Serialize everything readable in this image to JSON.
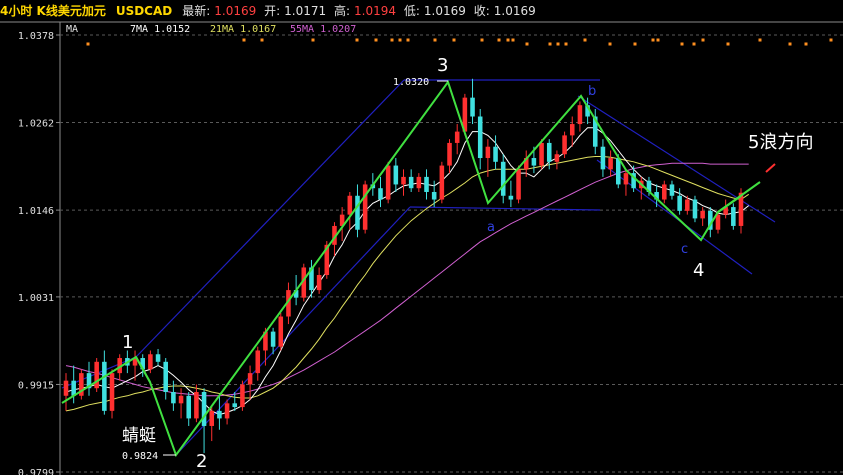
{
  "header": {
    "title": "4小时 K线美元加元",
    "symbol": "USDCAD",
    "latest_label": "最新:",
    "latest": "1.0169",
    "open_label": "开:",
    "open": "1.0171",
    "high_label": "高:",
    "high": "1.0194",
    "low_label": "低:",
    "low": "1.0169",
    "close_label": "收:",
    "close": "1.0169"
  },
  "ma_legend": {
    "label": "MA",
    "ma7": "7MA 1.0152",
    "ma21": "21MA 1.0167",
    "ma55": "55MA 1.0207"
  },
  "colors": {
    "up": "#ff3030",
    "down": "#40e0e0",
    "ma7": "#ffffff",
    "ma21": "#e0e060",
    "ma55": "#d060d0",
    "wave": "#40e040",
    "channel": "#2020c0",
    "grid": "#5a5a5a"
  },
  "annotations": {
    "w1": "1",
    "w2": "2",
    "w3": "3",
    "w4": "4",
    "w5": "5浪方向",
    "a": "a",
    "b": "b",
    "c": "c",
    "dragonfly": "蜻蜓",
    "high_price": "1.0320",
    "low_price": "0.9824"
  },
  "chart_data": {
    "type": "candlestick",
    "y_ticks": [
      "1.0378",
      "1.0262",
      "1.0146",
      "1.0031",
      "0.9915",
      "0.9799"
    ],
    "ylim": [
      0.9799,
      1.0378
    ],
    "candles": [
      [
        0.99,
        0.993,
        0.988,
        0.992
      ],
      [
        0.992,
        0.994,
        0.989,
        0.99
      ],
      [
        0.99,
        0.9935,
        0.9895,
        0.993
      ],
      [
        0.993,
        0.9945,
        0.99,
        0.991
      ],
      [
        0.991,
        0.995,
        0.9905,
        0.9945
      ],
      [
        0.9945,
        0.996,
        0.9875,
        0.988
      ],
      [
        0.988,
        0.9935,
        0.987,
        0.993
      ],
      [
        0.993,
        0.9955,
        0.992,
        0.995
      ],
      [
        0.995,
        0.996,
        0.993,
        0.994
      ],
      [
        0.994,
        0.996,
        0.992,
        0.995
      ],
      [
        0.995,
        0.9955,
        0.9925,
        0.9935
      ],
      [
        0.9935,
        0.996,
        0.993,
        0.9955
      ],
      [
        0.9955,
        0.9962,
        0.994,
        0.9945
      ],
      [
        0.9945,
        0.995,
        0.9895,
        0.9905
      ],
      [
        0.9905,
        0.992,
        0.988,
        0.989
      ],
      [
        0.989,
        0.991,
        0.987,
        0.99
      ],
      [
        0.99,
        0.9905,
        0.986,
        0.987
      ],
      [
        0.987,
        0.9915,
        0.9865,
        0.9905
      ],
      [
        0.9905,
        0.991,
        0.9824,
        0.986
      ],
      [
        0.986,
        0.9885,
        0.984,
        0.988
      ],
      [
        0.988,
        0.99,
        0.9855,
        0.987
      ],
      [
        0.987,
        0.9895,
        0.9862,
        0.989
      ],
      [
        0.989,
        0.9905,
        0.988,
        0.9885
      ],
      [
        0.9885,
        0.992,
        0.988,
        0.9915
      ],
      [
        0.9915,
        0.994,
        0.9895,
        0.993
      ],
      [
        0.993,
        0.9965,
        0.992,
        0.996
      ],
      [
        0.996,
        0.999,
        0.994,
        0.9985
      ],
      [
        0.9985,
        0.999,
        0.9955,
        0.9965
      ],
      [
        0.9965,
        1.001,
        0.996,
        1.0005
      ],
      [
        1.0005,
        1.005,
        0.9995,
        1.004
      ],
      [
        1.004,
        1.006,
        1.002,
        1.003
      ],
      [
        1.003,
        1.0075,
        1.0025,
        1.007
      ],
      [
        1.007,
        1.008,
        1.003,
        1.004
      ],
      [
        1.004,
        1.007,
        1.0035,
        1.006
      ],
      [
        1.006,
        1.0105,
        1.0055,
        1.01
      ],
      [
        1.01,
        1.013,
        1.0085,
        1.0125
      ],
      [
        1.0125,
        1.015,
        1.0105,
        1.014
      ],
      [
        1.014,
        1.017,
        1.012,
        1.0165
      ],
      [
        1.0165,
        1.018,
        1.011,
        1.012
      ],
      [
        1.012,
        1.0185,
        1.0115,
        1.018
      ],
      [
        1.018,
        1.0195,
        1.0165,
        1.0175
      ],
      [
        1.0175,
        1.019,
        1.015,
        1.016
      ],
      [
        1.016,
        1.021,
        1.0155,
        1.0205
      ],
      [
        1.0205,
        1.0215,
        1.017,
        1.018
      ],
      [
        1.018,
        1.02,
        1.0165,
        1.019
      ],
      [
        1.019,
        1.02,
        1.017,
        1.0175
      ],
      [
        1.0175,
        1.0195,
        1.017,
        1.019
      ],
      [
        1.019,
        1.02,
        1.016,
        1.017
      ],
      [
        1.017,
        1.0185,
        1.015,
        1.016
      ],
      [
        1.016,
        1.021,
        1.0155,
        1.0205
      ],
      [
        1.0205,
        1.024,
        1.0195,
        1.0235
      ],
      [
        1.0235,
        1.026,
        1.022,
        1.025
      ],
      [
        1.025,
        1.03,
        1.0245,
        1.0295
      ],
      [
        1.0295,
        1.032,
        1.026,
        1.027
      ],
      [
        1.027,
        1.028,
        1.02,
        1.0215
      ],
      [
        1.0215,
        1.024,
        1.019,
        1.023
      ],
      [
        1.023,
        1.0245,
        1.02,
        1.021
      ],
      [
        1.021,
        1.022,
        1.0155,
        1.0165
      ],
      [
        1.0165,
        1.0185,
        1.015,
        1.016
      ],
      [
        1.016,
        1.0205,
        1.0155,
        1.02
      ],
      [
        1.02,
        1.0225,
        1.019,
        1.0215
      ],
      [
        1.0215,
        1.023,
        1.0195,
        1.0205
      ],
      [
        1.0205,
        1.024,
        1.02,
        1.0235
      ],
      [
        1.0235,
        1.024,
        1.02,
        1.021
      ],
      [
        1.021,
        1.0225,
        1.02,
        1.022
      ],
      [
        1.022,
        1.025,
        1.0215,
        1.0245
      ],
      [
        1.0245,
        1.027,
        1.023,
        1.026
      ],
      [
        1.026,
        1.029,
        1.025,
        1.0285
      ],
      [
        1.0285,
        1.0295,
        1.026,
        1.027
      ],
      [
        1.027,
        1.028,
        1.022,
        1.023
      ],
      [
        1.023,
        1.024,
        1.019,
        1.02
      ],
      [
        1.02,
        1.0225,
        1.019,
        1.0215
      ],
      [
        1.0215,
        1.022,
        1.0175,
        1.018
      ],
      [
        1.018,
        1.02,
        1.0165,
        1.0195
      ],
      [
        1.0195,
        1.0205,
        1.017,
        1.0175
      ],
      [
        1.0175,
        1.019,
        1.016,
        1.0185
      ],
      [
        1.0185,
        1.019,
        1.0165,
        1.017
      ],
      [
        1.017,
        1.018,
        1.015,
        1.016
      ],
      [
        1.016,
        1.0185,
        1.0155,
        1.018
      ],
      [
        1.018,
        1.0185,
        1.016,
        1.0165
      ],
      [
        1.0165,
        1.0175,
        1.014,
        1.0145
      ],
      [
        1.0145,
        1.0165,
        1.014,
        1.016
      ],
      [
        1.016,
        1.0165,
        1.013,
        1.0135
      ],
      [
        1.0135,
        1.015,
        1.0125,
        1.0145
      ],
      [
        1.0145,
        1.015,
        1.011,
        1.012
      ],
      [
        1.012,
        1.0145,
        1.0115,
        1.014
      ],
      [
        1.014,
        1.016,
        1.0135,
        1.015
      ],
      [
        1.015,
        1.0155,
        1.012,
        1.0125
      ],
      [
        1.0125,
        1.0175,
        1.0115,
        1.0169
      ]
    ],
    "ma7": [
      0.9905,
      0.9908,
      0.991,
      0.9912,
      0.9915,
      0.9912,
      0.991,
      0.9915,
      0.992,
      0.9925,
      0.9932,
      0.9935,
      0.994,
      0.9935,
      0.9927,
      0.9918,
      0.9908,
      0.99,
      0.989,
      0.988,
      0.9875,
      0.9878,
      0.9882,
      0.9887,
      0.9895,
      0.9908,
      0.9925,
      0.994,
      0.996,
      0.9982,
      1.0,
      1.002,
      1.0035,
      1.005,
      1.0065,
      1.0085,
      1.01,
      1.012,
      1.013,
      1.0145,
      1.0155,
      1.016,
      1.0165,
      1.0172,
      1.0178,
      1.018,
      1.0182,
      1.018,
      1.0178,
      1.0185,
      1.0195,
      1.021,
      1.0235,
      1.025,
      1.025,
      1.0245,
      1.0235,
      1.022,
      1.0205,
      1.0195,
      1.0195,
      1.019,
      1.02,
      1.021,
      1.0215,
      1.0222,
      1.0232,
      1.0245,
      1.0255,
      1.0255,
      1.0248,
      1.0238,
      1.0225,
      1.0212,
      1.02,
      1.019,
      1.0182,
      1.0178,
      1.0175,
      1.0172,
      1.0168,
      1.0162,
      1.0158,
      1.0152,
      1.0148,
      1.0142,
      1.014,
      1.0142,
      1.0144,
      1.0152
    ],
    "ma21": [
      0.988,
      0.9882,
      0.9885,
      0.9888,
      0.989,
      0.9892,
      0.9895,
      0.9898,
      0.99,
      0.9903,
      0.9905,
      0.9908,
      0.991,
      0.9912,
      0.9913,
      0.9913,
      0.9912,
      0.991,
      0.9908,
      0.9905,
      0.9903,
      0.99,
      0.9898,
      0.9897,
      0.9897,
      0.99,
      0.9905,
      0.991,
      0.9918,
      0.9928,
      0.9938,
      0.995,
      0.9962,
      0.9975,
      0.999,
      1.0003,
      1.0018,
      1.0032,
      1.0047,
      1.006,
      1.0075,
      1.0088,
      1.01,
      1.0112,
      1.0122,
      1.0132,
      1.014,
      1.0148,
      1.0155,
      1.0162,
      1.0168,
      1.0175,
      1.0182,
      1.019,
      1.0195,
      1.0198,
      1.02,
      1.02,
      1.02,
      1.02,
      1.02,
      1.0202,
      1.0204,
      1.0206,
      1.0208,
      1.021,
      1.0212,
      1.0214,
      1.0216,
      1.0217,
      1.0217,
      1.0216,
      1.0214,
      1.0212,
      1.021,
      1.0207,
      1.0204,
      1.02,
      1.0196,
      1.0192,
      1.0188,
      1.0184,
      1.018,
      1.0176,
      1.0172,
      1.0168,
      1.0165,
      1.0162,
      1.016,
      1.0167
    ],
    "ma55": [
      0.994,
      0.9938,
      0.9935,
      0.9932,
      0.993,
      0.9927,
      0.9924,
      0.9921,
      0.9918,
      0.9915,
      0.9912,
      0.991,
      0.9908,
      0.9906,
      0.9904,
      0.9903,
      0.9902,
      0.9901,
      0.99,
      0.99,
      0.99,
      0.9901,
      0.9902,
      0.9904,
      0.9906,
      0.9909,
      0.9912,
      0.9915,
      0.9919,
      0.9924,
      0.9929,
      0.9934,
      0.994,
      0.9946,
      0.9952,
      0.9958,
      0.9965,
      0.9972,
      0.9979,
      0.9986,
      0.9993,
      1.0,
      1.0008,
      1.0016,
      1.0024,
      1.0032,
      1.004,
      1.0048,
      1.0056,
      1.0064,
      1.0072,
      1.008,
      1.0088,
      1.0096,
      1.0104,
      1.011,
      1.0116,
      1.0122,
      1.0128,
      1.0133,
      1.0138,
      1.0143,
      1.0148,
      1.0153,
      1.0158,
      1.0163,
      1.0168,
      1.0173,
      1.0178,
      1.0183,
      1.0187,
      1.0191,
      1.0195,
      1.0198,
      1.0201,
      1.0203,
      1.0205,
      1.0206,
      1.0207,
      1.0208,
      1.0208,
      1.0208,
      1.0208,
      1.0208,
      1.0207,
      1.0207,
      1.0207,
      1.0207,
      1.0207,
      1.0207
    ]
  }
}
